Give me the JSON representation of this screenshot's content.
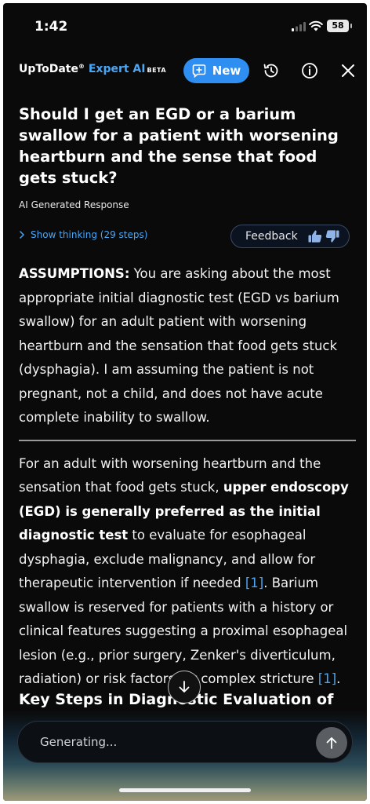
{
  "status_bar": {
    "time": "1:42",
    "battery": "58"
  },
  "header": {
    "brand_name": "UpToDate",
    "brand_reg": "®",
    "brand_product": "Expert AI",
    "brand_badge": "BETA",
    "new_button_label": "New"
  },
  "question": "Should I get an EGD or a barium swallow for a patient with worsening heartburn and the sense that food gets stuck?",
  "response_label": "AI Generated Response",
  "show_thinking_label": "Show thinking (29 steps)",
  "feedback_label": "Feedback",
  "assumptions": {
    "label": "ASSUMPTIONS:",
    "text": " You are asking about the most appropriate initial diagnostic test (EGD vs barium swallow) for an adult patient with worsening heartburn and the sensation that food gets stuck (dysphagia). I am assuming the patient is not pregnant, not a child, and does not have acute complete inability to swallow."
  },
  "answer": {
    "part1": "For an adult with worsening heartburn and the sensation that food gets stuck, ",
    "bold": "upper endoscopy (EGD) is generally preferred as the initial diagnostic test",
    "part2": " to evaluate for esophageal dysphagia, exclude malignancy, and allow for therapeutic intervention if needed ",
    "cite1": "[1]",
    "part3": ". Barium swallow is reserved for patients with a history or clinical features suggesting a proximal esophageal lesion (e.g., prior surgery, Zenker's diverticulum, radiation) or risk factors for complex stricture ",
    "cite2": "[1]",
    "part4": "."
  },
  "key_steps_heading": "Key Steps in Diagnostic Evaluation of",
  "input": {
    "placeholder": "Generating..."
  },
  "colors": {
    "accent": "#2e8ef2",
    "link": "#4aa6f5",
    "background": "#0a0a0a"
  }
}
